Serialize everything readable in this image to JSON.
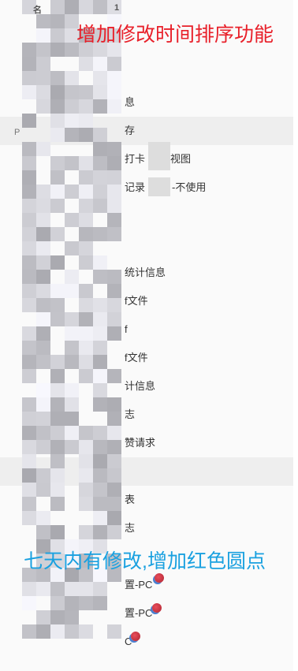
{
  "header": {
    "fragment_left": "名",
    "fragment_right": "1"
  },
  "stray_label": "P",
  "annotations": {
    "sort_feature": "增加修改时间排序功能",
    "recent_change": "七天内有修改,增加红色圆点"
  },
  "menu": {
    "items": [
      {
        "label": "息",
        "recent": false
      },
      {
        "label": "存",
        "recent": false
      },
      {
        "label": "打卡",
        "recent": false
      },
      {
        "label": "视图",
        "recent": false
      },
      {
        "label": "记录",
        "recent": false
      },
      {
        "label": "-不使用",
        "recent": false
      },
      {
        "label": "统计信息",
        "recent": false
      },
      {
        "label": "f文件",
        "recent": false
      },
      {
        "label": "f",
        "recent": false
      },
      {
        "label": "f文件",
        "recent": false
      },
      {
        "label": "计信息",
        "recent": false
      },
      {
        "label": "志",
        "recent": false
      },
      {
        "label": "赞请求",
        "recent": false
      },
      {
        "label": "表",
        "recent": false
      },
      {
        "label": "志",
        "recent": false
      },
      {
        "label": "置-PC",
        "recent": true
      },
      {
        "label": "置-PC",
        "recent": true
      },
      {
        "label": "C",
        "recent": true
      }
    ]
  },
  "colors": {
    "annotation_red": "#e8202a",
    "annotation_blue": "#1aa1e0",
    "recent_dot": "#d43a48"
  }
}
